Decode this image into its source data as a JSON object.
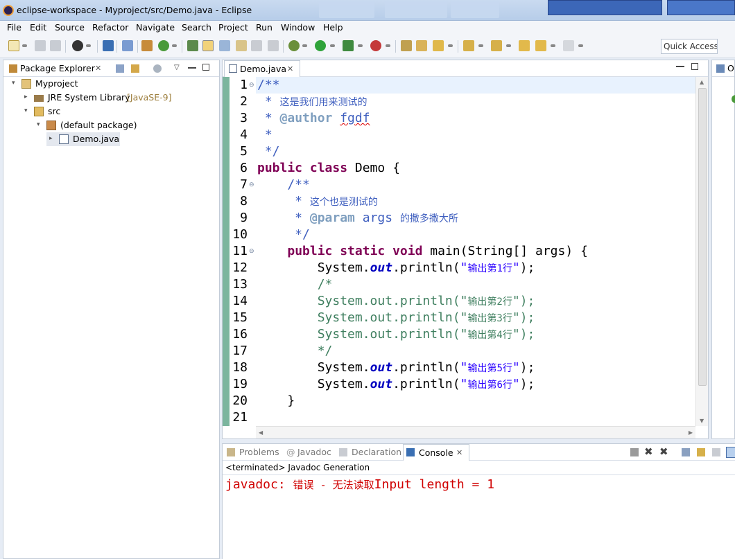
{
  "window": {
    "title": "eclipse-workspace - Myproject/src/Demo.java - Eclipse",
    "quick_access": "Quick Access"
  },
  "menu": [
    "File",
    "Edit",
    "Source",
    "Refactor",
    "Navigate",
    "Search",
    "Project",
    "Run",
    "Window",
    "Help"
  ],
  "package_explorer": {
    "tab_label": "Package Explorer",
    "tree": [
      {
        "label": "Myproject",
        "decoration": "",
        "icon": "project-icon",
        "twisty": "▾"
      },
      {
        "label": "JRE System Library",
        "decoration": "[JavaSE-9]",
        "icon": "library-icon",
        "twisty": "▸"
      },
      {
        "label": "src",
        "decoration": "",
        "icon": "source-folder-icon",
        "twisty": "▾"
      },
      {
        "label": "(default package)",
        "decoration": "",
        "icon": "package-icon",
        "twisty": "▾"
      },
      {
        "label": "Demo.java",
        "decoration": "",
        "icon": "java-file-icon",
        "twisty": "▸"
      }
    ]
  },
  "editor": {
    "tab_label": "Demo.java",
    "line_numbers": [
      "1",
      "2",
      "3",
      "4",
      "5",
      "6",
      "7",
      "8",
      "9",
      "10",
      "11",
      "12",
      "13",
      "14",
      "15",
      "16",
      "17",
      "18",
      "19",
      "20",
      "21"
    ],
    "fold_lines": [
      1,
      7,
      11
    ],
    "code": {
      "l1": "/**",
      "l2a": " * ",
      "l2b": "这是我们用来测试的",
      "l3a": " * ",
      "l3tag": "@author",
      "l3b": " ",
      "l3c": "fgdf",
      "l4": " *",
      "l5": " */",
      "l6kw": "public class",
      "l6rest": " Demo {",
      "l7": "    /**",
      "l8a": "     * ",
      "l8b": "这个也是测试的",
      "l9a": "     * ",
      "l9tag": "@param",
      "l9b": " args ",
      "l9c": "的撒多撒大所",
      "l10": "     */",
      "l11ind": "    ",
      "l11kw": "public static void",
      "l11rest": " main(String[] args) {",
      "l12a": "        System.",
      "l12f": "out",
      "l12b": ".println(",
      "l12s1": "\"",
      "l12s2": "输出第1行",
      "l12s3": "\"",
      "l12c": ");",
      "l13": "        /*",
      "l14a": "        System.out.println(\"",
      "l14b": "输出第2行",
      "l14c": "\");",
      "l15a": "        System.out.println(\"",
      "l15b": "输出第3行",
      "l15c": "\");",
      "l16a": "        System.out.println(\"",
      "l16b": "输出第4行",
      "l16c": "\");",
      "l17": "        */",
      "l18a": "        System.",
      "l18f": "out",
      "l18b": ".println(",
      "l18s1": "\"",
      "l18s2": "输出第5行",
      "l18s3": "\"",
      "l18c": ");",
      "l19a": "        System.",
      "l19f": "out",
      "l19b": ".println(",
      "l19s1": "\"",
      "l19s2": "输出第6行",
      "l19s3": "\"",
      "l19c": ");",
      "l20": "    }",
      "l21": ""
    }
  },
  "bottom": {
    "tabs": [
      "Problems",
      "Javadoc",
      "Declaration",
      "Console"
    ],
    "status": "<terminated> Javadoc Generation",
    "output": {
      "a": "javadoc: ",
      "b": "错误 - 无法读取",
      "c": "Input length = 1"
    }
  },
  "outline": {
    "tab_label": "O"
  },
  "colors": {
    "keyword": "#7f0055",
    "javadoc": "#3f5fbf",
    "javadoc_tag": "#7f9fbf",
    "comment": "#3f7f5f",
    "string": "#2a00ff",
    "field": "#0000c0",
    "error": "#d00000"
  }
}
